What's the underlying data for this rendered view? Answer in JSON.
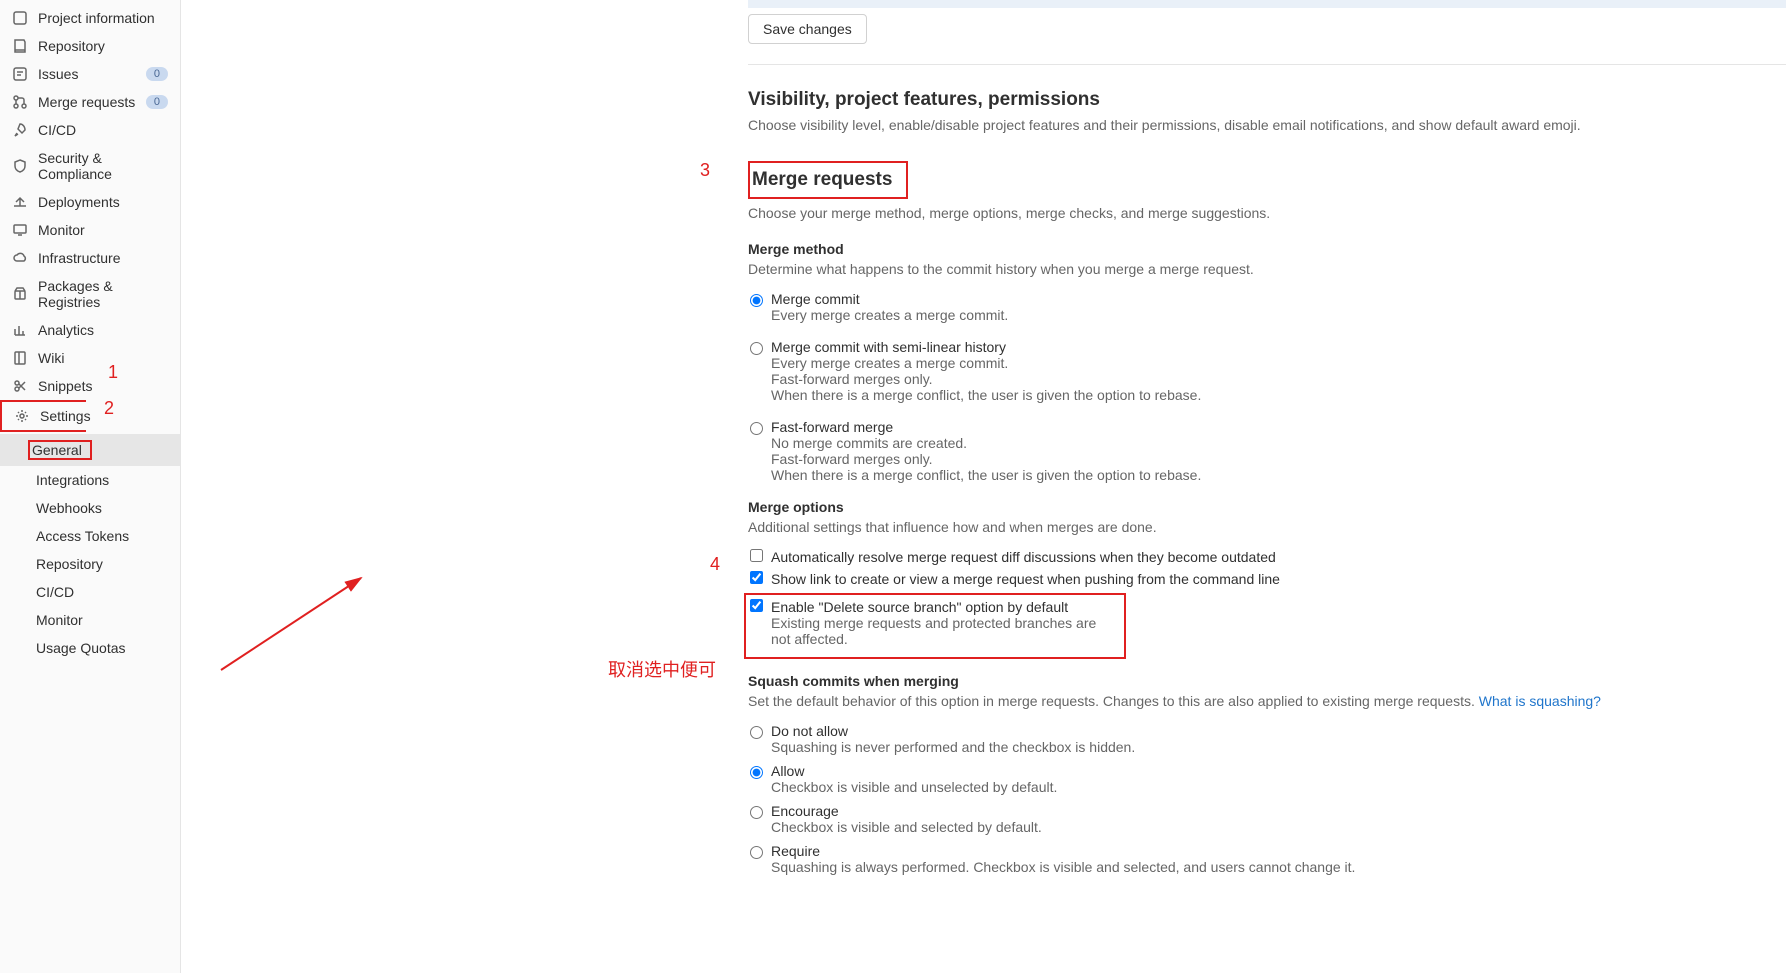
{
  "sidebar": {
    "items": [
      {
        "label": "Project information",
        "icon": "info"
      },
      {
        "label": "Repository",
        "icon": "repo"
      },
      {
        "label": "Issues",
        "icon": "issues",
        "badge": "0"
      },
      {
        "label": "Merge requests",
        "icon": "merge",
        "badge": "0"
      },
      {
        "label": "CI/CD",
        "icon": "cicd"
      },
      {
        "label": "Security & Compliance",
        "icon": "shield"
      },
      {
        "label": "Deployments",
        "icon": "deploy"
      },
      {
        "label": "Monitor",
        "icon": "monitor"
      },
      {
        "label": "Infrastructure",
        "icon": "infra"
      },
      {
        "label": "Packages & Registries",
        "icon": "package"
      },
      {
        "label": "Analytics",
        "icon": "analytics"
      },
      {
        "label": "Wiki",
        "icon": "wiki"
      },
      {
        "label": "Snippets",
        "icon": "snippets"
      },
      {
        "label": "Settings",
        "icon": "settings"
      }
    ],
    "sub": [
      {
        "label": "General",
        "active": true
      },
      {
        "label": "Integrations"
      },
      {
        "label": "Webhooks"
      },
      {
        "label": "Access Tokens"
      },
      {
        "label": "Repository"
      },
      {
        "label": "CI/CD"
      },
      {
        "label": "Monitor"
      },
      {
        "label": "Usage Quotas"
      }
    ]
  },
  "buttons": {
    "save": "Save changes"
  },
  "visibility": {
    "title": "Visibility, project features, permissions",
    "desc": "Choose visibility level, enable/disable project features and their permissions, disable email notifications, and show default award emoji."
  },
  "mr": {
    "title": "Merge requests",
    "desc": "Choose your merge method, merge options, merge checks, and merge suggestions.",
    "method": {
      "title": "Merge method",
      "desc": "Determine what happens to the commit history when you merge a merge request.",
      "opts": [
        {
          "label": "Merge commit",
          "sub": [
            "Every merge creates a merge commit."
          ]
        },
        {
          "label": "Merge commit with semi-linear history",
          "sub": [
            "Every merge creates a merge commit.",
            "Fast-forward merges only.",
            "When there is a merge conflict, the user is given the option to rebase."
          ]
        },
        {
          "label": "Fast-forward merge",
          "sub": [
            "No merge commits are created.",
            "Fast-forward merges only.",
            "When there is a merge conflict, the user is given the option to rebase."
          ]
        }
      ]
    },
    "options": {
      "title": "Merge options",
      "desc": "Additional settings that influence how and when merges are done.",
      "checks": [
        {
          "label": "Automatically resolve merge request diff discussions when they become outdated",
          "checked": false
        },
        {
          "label": "Show link to create or view a merge request when pushing from the command line",
          "checked": true
        },
        {
          "label": "Enable \"Delete source branch\" option by default",
          "sub": "Existing merge requests and protected branches are not affected.",
          "checked": true
        }
      ]
    },
    "squash": {
      "title": "Squash commits when merging",
      "desc": "Set the default behavior of this option in merge requests. Changes to this are also applied to existing merge requests. ",
      "link": "What is squashing?",
      "opts": [
        {
          "label": "Do not allow",
          "sub": "Squashing is never performed and the checkbox is hidden."
        },
        {
          "label": "Allow",
          "sub": "Checkbox is visible and unselected by default."
        },
        {
          "label": "Encourage",
          "sub": "Checkbox is visible and selected by default."
        },
        {
          "label": "Require",
          "sub": "Squashing is always performed. Checkbox is visible and selected, and users cannot change it."
        }
      ]
    }
  },
  "anno": {
    "n1": "1",
    "n2": "2",
    "n3": "3",
    "n4": "4",
    "text": "取消选中便可"
  }
}
